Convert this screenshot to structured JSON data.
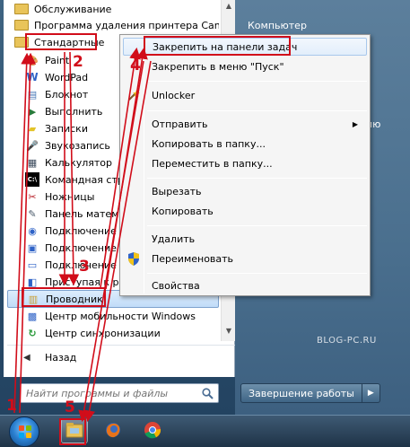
{
  "right_pane": {
    "computer": "Компьютер",
    "partial_item": "ию"
  },
  "programs": [
    {
      "label": "Обслуживание",
      "type": "folder"
    },
    {
      "label": "Программа удаления принтера Canon",
      "type": "folder"
    },
    {
      "label": "Стандартные",
      "type": "folder"
    },
    {
      "label": "Paint",
      "type": "app",
      "icon": "paint-icon"
    },
    {
      "label": "WordPad",
      "type": "app",
      "icon": "wordpad-icon"
    },
    {
      "label": "Блокнот",
      "type": "app",
      "icon": "notepad-icon"
    },
    {
      "label": "Выполнить",
      "type": "app",
      "icon": "run-icon"
    },
    {
      "label": "Записки",
      "type": "app",
      "icon": "sticky-notes-icon"
    },
    {
      "label": "Звукозапись",
      "type": "app",
      "icon": "microphone-icon"
    },
    {
      "label": "Калькулятор",
      "type": "app",
      "icon": "calculator-icon"
    },
    {
      "label": "Командная стр",
      "type": "app",
      "icon": "command-prompt-icon"
    },
    {
      "label": "Ножницы",
      "type": "app",
      "icon": "scissors-icon"
    },
    {
      "label": "Панель матем",
      "type": "app",
      "icon": "math-panel-icon"
    },
    {
      "label": "Подключение",
      "type": "app",
      "icon": "network-icon"
    },
    {
      "label": "Подключение",
      "type": "app",
      "icon": "projector-icon"
    },
    {
      "label": "Подключение",
      "type": "app",
      "icon": "remote-desktop-icon"
    },
    {
      "label": "Приступая к р",
      "type": "app",
      "icon": "getting-started-icon"
    },
    {
      "label": "Проводник",
      "type": "app",
      "icon": "explorer-icon"
    },
    {
      "label": "Центр мобильности Windows",
      "type": "app",
      "icon": "mobility-center-icon"
    },
    {
      "label": "Центр синхронизации",
      "type": "app",
      "icon": "sync-center-icon"
    }
  ],
  "back_label": "Назад",
  "search": {
    "placeholder": "Найти программы и файлы"
  },
  "shutdown_label": "Завершение работы",
  "watermark": "BLOG-PC.RU",
  "context_menu": {
    "pin_taskbar": "Закрепить на панели задач",
    "pin_start": "Закрепить в меню \"Пуск\"",
    "unlocker": "Unlocker",
    "send_to": "Отправить",
    "copy_to_folder": "Копировать в папку...",
    "move_to_folder": "Переместить в папку...",
    "cut": "Вырезать",
    "copy": "Копировать",
    "delete": "Удалить",
    "rename": "Переименовать",
    "properties": "Свойства"
  },
  "annotations": {
    "n1": "1",
    "n2": "2",
    "n3": "3",
    "n4": "4",
    "n5": "5"
  },
  "colors": {
    "annotation": "#d10d1a",
    "highlight": "#c1dcf8"
  }
}
